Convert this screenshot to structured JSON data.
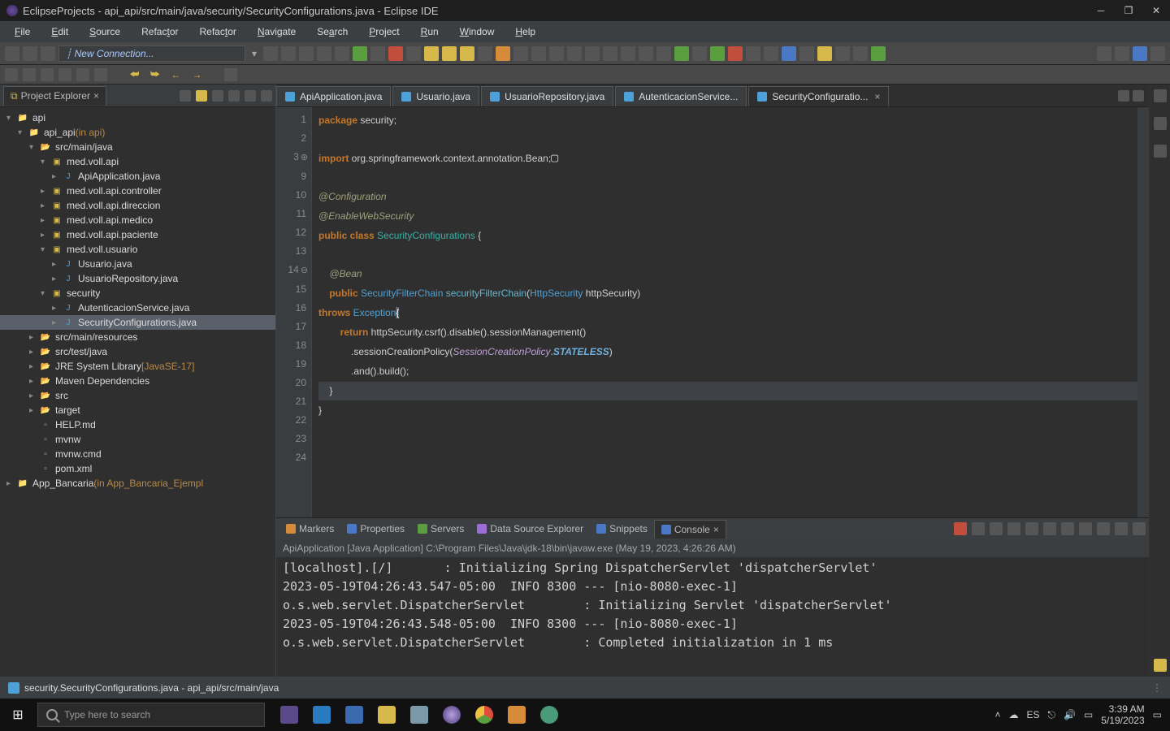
{
  "titlebar": {
    "title": "EclipseProjects - api_api/src/main/java/security/SecurityConfigurations.java - Eclipse IDE"
  },
  "menubar": {
    "items": [
      "File",
      "Edit",
      "Source",
      "Refactor",
      "Refactor",
      "Navigate",
      "Search",
      "Project",
      "Run",
      "Window",
      "Help"
    ]
  },
  "connection_field": "New Connection...",
  "project_explorer": {
    "title": "Project Explorer",
    "tree": [
      {
        "indent": 0,
        "caret": "▾",
        "icon": "proj",
        "label": "api",
        "anno": ""
      },
      {
        "indent": 1,
        "caret": "▾",
        "icon": "proj",
        "label": "api_api",
        "anno": " (in api)"
      },
      {
        "indent": 2,
        "caret": "▾",
        "icon": "fold",
        "label": "src/main/java",
        "anno": ""
      },
      {
        "indent": 3,
        "caret": "▾",
        "icon": "pkg",
        "label": "med.voll.api",
        "anno": ""
      },
      {
        "indent": 4,
        "caret": "▸",
        "icon": "java",
        "label": "ApiApplication.java",
        "anno": ""
      },
      {
        "indent": 3,
        "caret": "▸",
        "icon": "pkg",
        "label": "med.voll.api.controller",
        "anno": ""
      },
      {
        "indent": 3,
        "caret": "▸",
        "icon": "pkg",
        "label": "med.voll.api.direccion",
        "anno": ""
      },
      {
        "indent": 3,
        "caret": "▸",
        "icon": "pkg",
        "label": "med.voll.api.medico",
        "anno": ""
      },
      {
        "indent": 3,
        "caret": "▸",
        "icon": "pkg",
        "label": "med.voll.api.paciente",
        "anno": ""
      },
      {
        "indent": 3,
        "caret": "▾",
        "icon": "pkg",
        "label": "med.voll.usuario",
        "anno": ""
      },
      {
        "indent": 4,
        "caret": "▸",
        "icon": "java",
        "label": "Usuario.java",
        "anno": ""
      },
      {
        "indent": 4,
        "caret": "▸",
        "icon": "java",
        "label": "UsuarioRepository.java",
        "anno": ""
      },
      {
        "indent": 3,
        "caret": "▾",
        "icon": "pkg",
        "label": "security",
        "anno": ""
      },
      {
        "indent": 4,
        "caret": "▸",
        "icon": "java",
        "label": "AutenticacionService.java",
        "anno": ""
      },
      {
        "indent": 4,
        "caret": "▸",
        "icon": "java",
        "label": "SecurityConfigurations.java",
        "anno": "",
        "selected": true
      },
      {
        "indent": 2,
        "caret": "▸",
        "icon": "fold",
        "label": "src/main/resources",
        "anno": ""
      },
      {
        "indent": 2,
        "caret": "▸",
        "icon": "fold",
        "label": "src/test/java",
        "anno": ""
      },
      {
        "indent": 2,
        "caret": "▸",
        "icon": "fold",
        "label": "JRE System Library",
        "anno": " [JavaSE-17]"
      },
      {
        "indent": 2,
        "caret": "▸",
        "icon": "fold",
        "label": "Maven Dependencies",
        "anno": ""
      },
      {
        "indent": 2,
        "caret": "▸",
        "icon": "fold",
        "label": "src",
        "anno": ""
      },
      {
        "indent": 2,
        "caret": "▸",
        "icon": "fold",
        "label": "target",
        "anno": ""
      },
      {
        "indent": 2,
        "caret": "",
        "icon": "file",
        "label": "HELP.md",
        "anno": ""
      },
      {
        "indent": 2,
        "caret": "",
        "icon": "file",
        "label": "mvnw",
        "anno": ""
      },
      {
        "indent": 2,
        "caret": "",
        "icon": "file",
        "label": "mvnw.cmd",
        "anno": ""
      },
      {
        "indent": 2,
        "caret": "",
        "icon": "file",
        "label": "pom.xml",
        "anno": ""
      },
      {
        "indent": 0,
        "caret": "▸",
        "icon": "proj",
        "label": "App_Bancaria",
        "anno": " (in App_Bancaria_Ejempl"
      }
    ]
  },
  "editor_tabs": [
    {
      "label": "ApiApplication.java",
      "active": false
    },
    {
      "label": "Usuario.java",
      "active": false
    },
    {
      "label": "UsuarioRepository.java",
      "active": false
    },
    {
      "label": "AutenticacionService...",
      "active": false
    },
    {
      "label": "SecurityConfiguratio...",
      "active": true,
      "close": true
    }
  ],
  "code_lines": {
    "gutters": [
      "1",
      "2",
      "3",
      "9",
      "10",
      "11",
      "12",
      "13",
      "14",
      "15",
      "",
      "16",
      "17",
      "18",
      "19",
      "20",
      "21",
      "22",
      "23",
      "24"
    ],
    "l1_a": "package",
    "l1_b": " security;",
    "l3_a": "import",
    "l3_b": " org.springframework.context.annotation.Bean;",
    "l10": "@Configuration",
    "l11": "@EnableWebSecurity",
    "l12_a": "public class",
    "l12_b": " SecurityConfigurations",
    "l12_c": " {",
    "l14": "    @Bean",
    "l15_a": "    public",
    "l15_b": " SecurityFilterChain",
    "l15_c": " securityFilterChain",
    "l15_d": "(",
    "l15_e": "HttpSecurity",
    "l15_f": " httpSecurity) ",
    "l15w_a": "throws",
    "l15w_b": " Exception",
    "l15w_c": "{",
    "l16_a": "        return",
    "l16_b": " httpSecurity.csrf().disable().sessionManagement()",
    "l17_a": "            .sessionCreationPolicy(",
    "l17_b": "SessionCreationPolicy",
    "l17_c": ".",
    "l17_d": "STATELESS",
    "l17_e": ")",
    "l18": "            .and().build();",
    "l19": "    }",
    "l20": "}"
  },
  "bottom_tabs": [
    {
      "label": "Markers",
      "iconclass": "orsq"
    },
    {
      "label": "Properties",
      "iconclass": "bluesq"
    },
    {
      "label": "Servers",
      "iconclass": "greensq"
    },
    {
      "label": "Data Source Explorer",
      "iconclass": "pursq"
    },
    {
      "label": "Snippets",
      "iconclass": "bluesq"
    },
    {
      "label": "Console",
      "iconclass": "bluesq",
      "active": true,
      "close": true
    }
  ],
  "console": {
    "header": "ApiApplication [Java Application] C:\\Program Files\\Java\\jdk-18\\bin\\javaw.exe  (May 19, 2023, 4:26:26 AM)",
    "lines": [
      "[localhost].[/]       : Initializing Spring DispatcherServlet 'dispatcherServlet'",
      "2023-05-19T04:26:43.547-05:00  INFO 8300 --- [nio-8080-exec-1]",
      "o.s.web.servlet.DispatcherServlet        : Initializing Servlet 'dispatcherServlet'",
      "2023-05-19T04:26:43.548-05:00  INFO 8300 --- [nio-8080-exec-1]",
      "o.s.web.servlet.DispatcherServlet        : Completed initialization in 1 ms"
    ]
  },
  "statusbar": {
    "text": "security.SecurityConfigurations.java - api_api/src/main/java"
  },
  "taskbar": {
    "search_placeholder": "Type here to search",
    "lang": "ES",
    "time": "3:39 AM",
    "date": "5/19/2023"
  }
}
